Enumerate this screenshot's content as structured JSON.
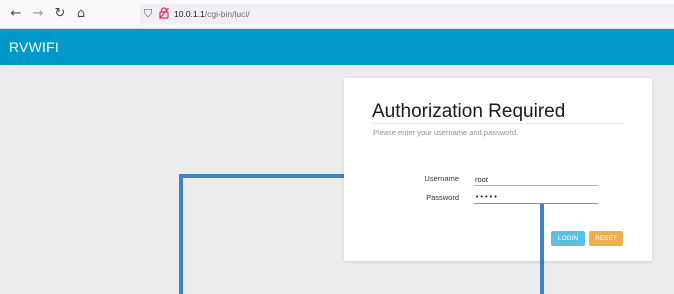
{
  "browser": {
    "icons": {
      "back": "back-arrow-icon",
      "forward": "forward-arrow-icon",
      "reload": "reload-icon",
      "home": "home-icon",
      "shield": "shield-icon",
      "insecure": "insecure-lock-icon"
    },
    "url_host": "10.0.1.1",
    "url_path": "/cgi-bin/luci/"
  },
  "header": {
    "brand": "RVWIFI",
    "color": "#0099c9"
  },
  "login": {
    "title": "Authorization Required",
    "subtitle": "Please enter your username and password.",
    "username_label": "Username",
    "username_value": "root",
    "password_label": "Password",
    "password_value": "•••••",
    "login_label": "LOGIN",
    "reset_label": "RESET",
    "login_color": "#5bc0de",
    "reset_color": "#f0ad4e"
  },
  "annotation_color": "#3c84c3"
}
